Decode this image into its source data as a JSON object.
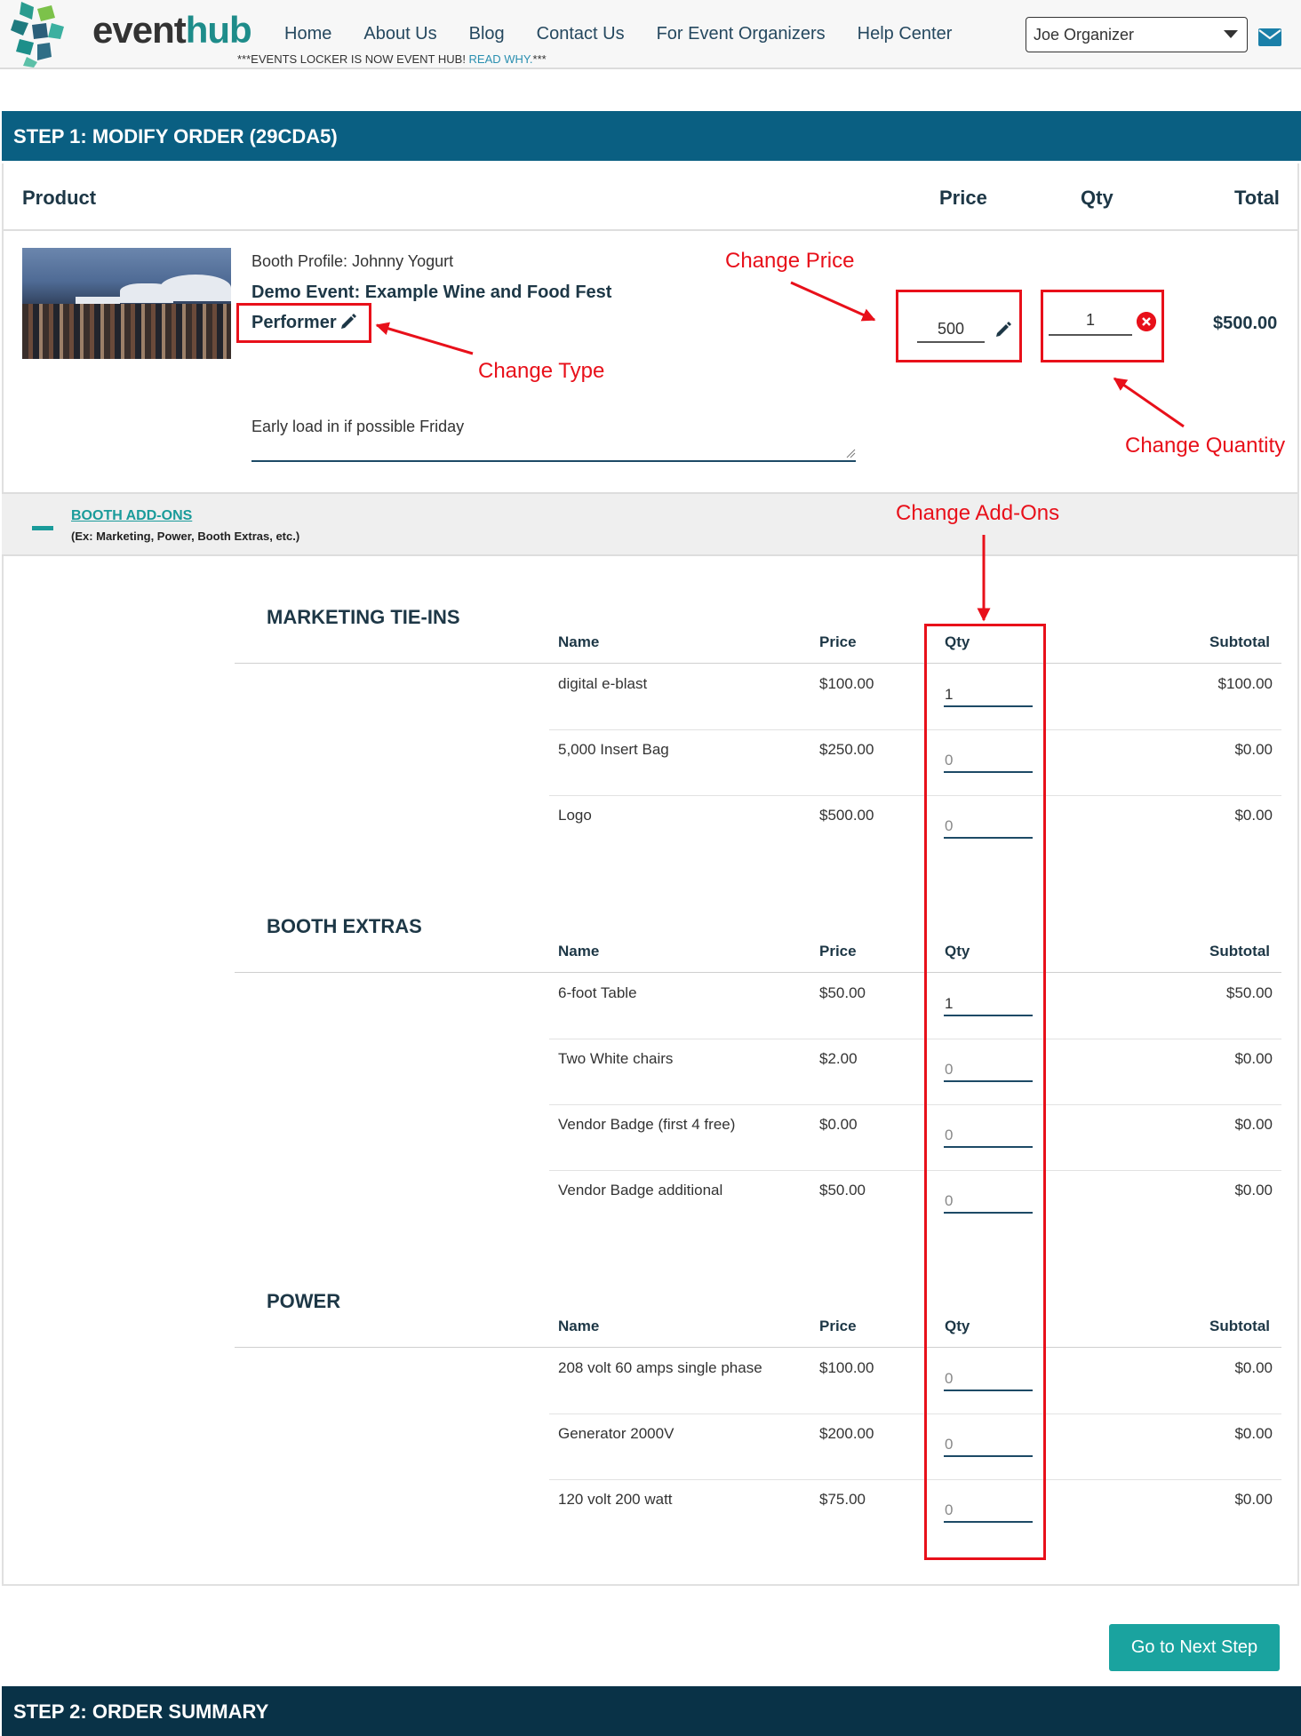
{
  "header": {
    "logo_text_a": "event",
    "logo_text_b": "hub",
    "nav": [
      "Home",
      "About Us",
      "Blog",
      "Contact Us",
      "For Event Organizers",
      "Help Center"
    ],
    "notice_text": "***EVENTS LOCKER IS NOW EVENT HUB! ",
    "notice_link": "READ WHY.",
    "notice_end": "***",
    "user": "Joe Organizer",
    "mail_icon": "envelope-icon"
  },
  "step1": {
    "title": "STEP 1: MODIFY ORDER (29CDA5)",
    "columns": {
      "product": "Product",
      "price": "Price",
      "qty": "Qty",
      "total": "Total"
    },
    "item": {
      "booth_profile": "Booth Profile: Johnny Yogurt",
      "event": "Demo Event: Example Wine and Food Fest",
      "type": "Performer",
      "price": "500",
      "qty": "1",
      "total": "$500.00",
      "notes": "Early load in if possible Friday"
    },
    "annotations": {
      "change_price": "Change Price",
      "change_type": "Change Type",
      "change_quantity": "Change Quantity",
      "change_addons": "Change Add-Ons"
    },
    "addons": {
      "title": "BOOTH ADD-ONS",
      "subtitle": "(Ex: Marketing, Power, Booth Extras, etc.)",
      "sections": [
        {
          "title": "MARKETING TIE-INS",
          "headers": [
            "Name",
            "Price",
            "Qty",
            "Subtotal"
          ],
          "rows": [
            {
              "name": "digital e-blast",
              "price": "$100.00",
              "qty": "1",
              "subtotal": "$100.00"
            },
            {
              "name": "5,000 Insert Bag",
              "price": "$250.00",
              "qty": "0",
              "subtotal": "$0.00"
            },
            {
              "name": "Logo",
              "price": "$500.00",
              "qty": "0",
              "subtotal": "$0.00"
            }
          ]
        },
        {
          "title": "BOOTH EXTRAS",
          "headers": [
            "Name",
            "Price",
            "Qty",
            "Subtotal"
          ],
          "rows": [
            {
              "name": "6-foot Table",
              "price": "$50.00",
              "qty": "1",
              "subtotal": "$50.00"
            },
            {
              "name": "Two White chairs",
              "price": "$2.00",
              "qty": "0",
              "subtotal": "$0.00"
            },
            {
              "name": "Vendor Badge (first 4 free)",
              "price": "$0.00",
              "qty": "0",
              "subtotal": "$0.00"
            },
            {
              "name": "Vendor Badge additional",
              "price": "$50.00",
              "qty": "0",
              "subtotal": "$0.00"
            }
          ]
        },
        {
          "title": "POWER",
          "headers": [
            "Name",
            "Price",
            "Qty",
            "Subtotal"
          ],
          "rows": [
            {
              "name": "208 volt 60 amps single phase",
              "price": "$100.00",
              "qty": "0",
              "subtotal": "$0.00"
            },
            {
              "name": "Generator 2000V",
              "price": "$200.00",
              "qty": "0",
              "subtotal": "$0.00"
            },
            {
              "name": "120 volt 200 watt",
              "price": "$75.00",
              "qty": "0",
              "subtotal": "$0.00"
            }
          ]
        }
      ]
    },
    "next_button": "Go to Next Step"
  },
  "step2": {
    "title": "STEP 2: ORDER SUMMARY"
  },
  "colors": {
    "primary": "#0a5f82",
    "dark": "#093247",
    "accent": "#1aa39f",
    "annotation": "#e8101a"
  }
}
